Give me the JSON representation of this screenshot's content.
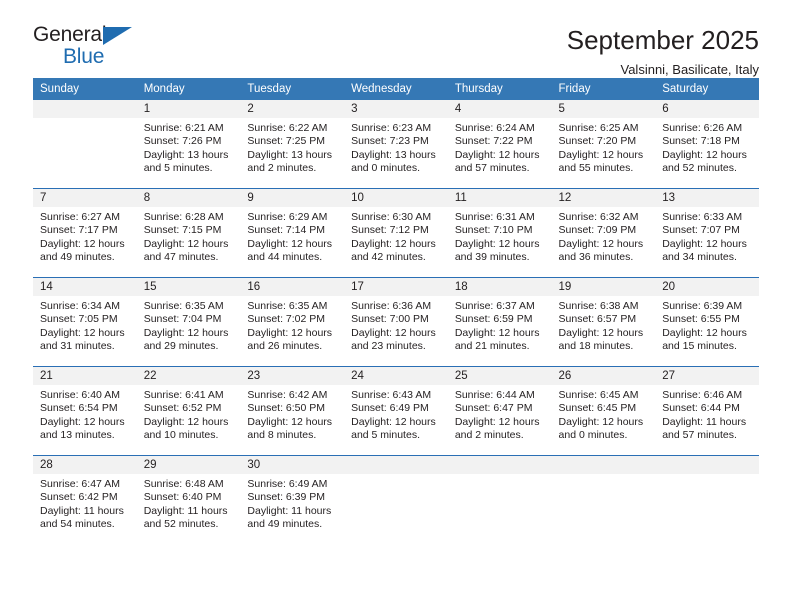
{
  "brand": {
    "name_dark": "General",
    "name_blue": "Blue",
    "accent_color": "#1f6cb0"
  },
  "header": {
    "title": "September 2025",
    "subtitle": "Valsinni, Basilicate, Italy"
  },
  "theme": {
    "header_blue": "#3578b5",
    "row_divider": "#2a6fb5",
    "daynum_band": "#f2f2f2",
    "text": "#231f20"
  },
  "weekdays": [
    "Sunday",
    "Monday",
    "Tuesday",
    "Wednesday",
    "Thursday",
    "Friday",
    "Saturday"
  ],
  "weeks": [
    [
      {
        "day": "",
        "sunrise": "",
        "sunset": "",
        "daylight_1": "",
        "daylight_2": "",
        "empty": true
      },
      {
        "day": "1",
        "sunrise": "Sunrise: 6:21 AM",
        "sunset": "Sunset: 7:26 PM",
        "daylight_1": "Daylight: 13 hours",
        "daylight_2": "and 5 minutes."
      },
      {
        "day": "2",
        "sunrise": "Sunrise: 6:22 AM",
        "sunset": "Sunset: 7:25 PM",
        "daylight_1": "Daylight: 13 hours",
        "daylight_2": "and 2 minutes."
      },
      {
        "day": "3",
        "sunrise": "Sunrise: 6:23 AM",
        "sunset": "Sunset: 7:23 PM",
        "daylight_1": "Daylight: 13 hours",
        "daylight_2": "and 0 minutes."
      },
      {
        "day": "4",
        "sunrise": "Sunrise: 6:24 AM",
        "sunset": "Sunset: 7:22 PM",
        "daylight_1": "Daylight: 12 hours",
        "daylight_2": "and 57 minutes."
      },
      {
        "day": "5",
        "sunrise": "Sunrise: 6:25 AM",
        "sunset": "Sunset: 7:20 PM",
        "daylight_1": "Daylight: 12 hours",
        "daylight_2": "and 55 minutes."
      },
      {
        "day": "6",
        "sunrise": "Sunrise: 6:26 AM",
        "sunset": "Sunset: 7:18 PM",
        "daylight_1": "Daylight: 12 hours",
        "daylight_2": "and 52 minutes."
      }
    ],
    [
      {
        "day": "7",
        "sunrise": "Sunrise: 6:27 AM",
        "sunset": "Sunset: 7:17 PM",
        "daylight_1": "Daylight: 12 hours",
        "daylight_2": "and 49 minutes."
      },
      {
        "day": "8",
        "sunrise": "Sunrise: 6:28 AM",
        "sunset": "Sunset: 7:15 PM",
        "daylight_1": "Daylight: 12 hours",
        "daylight_2": "and 47 minutes."
      },
      {
        "day": "9",
        "sunrise": "Sunrise: 6:29 AM",
        "sunset": "Sunset: 7:14 PM",
        "daylight_1": "Daylight: 12 hours",
        "daylight_2": "and 44 minutes."
      },
      {
        "day": "10",
        "sunrise": "Sunrise: 6:30 AM",
        "sunset": "Sunset: 7:12 PM",
        "daylight_1": "Daylight: 12 hours",
        "daylight_2": "and 42 minutes."
      },
      {
        "day": "11",
        "sunrise": "Sunrise: 6:31 AM",
        "sunset": "Sunset: 7:10 PM",
        "daylight_1": "Daylight: 12 hours",
        "daylight_2": "and 39 minutes."
      },
      {
        "day": "12",
        "sunrise": "Sunrise: 6:32 AM",
        "sunset": "Sunset: 7:09 PM",
        "daylight_1": "Daylight: 12 hours",
        "daylight_2": "and 36 minutes."
      },
      {
        "day": "13",
        "sunrise": "Sunrise: 6:33 AM",
        "sunset": "Sunset: 7:07 PM",
        "daylight_1": "Daylight: 12 hours",
        "daylight_2": "and 34 minutes."
      }
    ],
    [
      {
        "day": "14",
        "sunrise": "Sunrise: 6:34 AM",
        "sunset": "Sunset: 7:05 PM",
        "daylight_1": "Daylight: 12 hours",
        "daylight_2": "and 31 minutes."
      },
      {
        "day": "15",
        "sunrise": "Sunrise: 6:35 AM",
        "sunset": "Sunset: 7:04 PM",
        "daylight_1": "Daylight: 12 hours",
        "daylight_2": "and 29 minutes."
      },
      {
        "day": "16",
        "sunrise": "Sunrise: 6:35 AM",
        "sunset": "Sunset: 7:02 PM",
        "daylight_1": "Daylight: 12 hours",
        "daylight_2": "and 26 minutes."
      },
      {
        "day": "17",
        "sunrise": "Sunrise: 6:36 AM",
        "sunset": "Sunset: 7:00 PM",
        "daylight_1": "Daylight: 12 hours",
        "daylight_2": "and 23 minutes."
      },
      {
        "day": "18",
        "sunrise": "Sunrise: 6:37 AM",
        "sunset": "Sunset: 6:59 PM",
        "daylight_1": "Daylight: 12 hours",
        "daylight_2": "and 21 minutes."
      },
      {
        "day": "19",
        "sunrise": "Sunrise: 6:38 AM",
        "sunset": "Sunset: 6:57 PM",
        "daylight_1": "Daylight: 12 hours",
        "daylight_2": "and 18 minutes."
      },
      {
        "day": "20",
        "sunrise": "Sunrise: 6:39 AM",
        "sunset": "Sunset: 6:55 PM",
        "daylight_1": "Daylight: 12 hours",
        "daylight_2": "and 15 minutes."
      }
    ],
    [
      {
        "day": "21",
        "sunrise": "Sunrise: 6:40 AM",
        "sunset": "Sunset: 6:54 PM",
        "daylight_1": "Daylight: 12 hours",
        "daylight_2": "and 13 minutes."
      },
      {
        "day": "22",
        "sunrise": "Sunrise: 6:41 AM",
        "sunset": "Sunset: 6:52 PM",
        "daylight_1": "Daylight: 12 hours",
        "daylight_2": "and 10 minutes."
      },
      {
        "day": "23",
        "sunrise": "Sunrise: 6:42 AM",
        "sunset": "Sunset: 6:50 PM",
        "daylight_1": "Daylight: 12 hours",
        "daylight_2": "and 8 minutes."
      },
      {
        "day": "24",
        "sunrise": "Sunrise: 6:43 AM",
        "sunset": "Sunset: 6:49 PM",
        "daylight_1": "Daylight: 12 hours",
        "daylight_2": "and 5 minutes."
      },
      {
        "day": "25",
        "sunrise": "Sunrise: 6:44 AM",
        "sunset": "Sunset: 6:47 PM",
        "daylight_1": "Daylight: 12 hours",
        "daylight_2": "and 2 minutes."
      },
      {
        "day": "26",
        "sunrise": "Sunrise: 6:45 AM",
        "sunset": "Sunset: 6:45 PM",
        "daylight_1": "Daylight: 12 hours",
        "daylight_2": "and 0 minutes."
      },
      {
        "day": "27",
        "sunrise": "Sunrise: 6:46 AM",
        "sunset": "Sunset: 6:44 PM",
        "daylight_1": "Daylight: 11 hours",
        "daylight_2": "and 57 minutes."
      }
    ],
    [
      {
        "day": "28",
        "sunrise": "Sunrise: 6:47 AM",
        "sunset": "Sunset: 6:42 PM",
        "daylight_1": "Daylight: 11 hours",
        "daylight_2": "and 54 minutes."
      },
      {
        "day": "29",
        "sunrise": "Sunrise: 6:48 AM",
        "sunset": "Sunset: 6:40 PM",
        "daylight_1": "Daylight: 11 hours",
        "daylight_2": "and 52 minutes."
      },
      {
        "day": "30",
        "sunrise": "Sunrise: 6:49 AM",
        "sunset": "Sunset: 6:39 PM",
        "daylight_1": "Daylight: 11 hours",
        "daylight_2": "and 49 minutes."
      },
      {
        "day": "",
        "sunrise": "",
        "sunset": "",
        "daylight_1": "",
        "daylight_2": "",
        "empty": true
      },
      {
        "day": "",
        "sunrise": "",
        "sunset": "",
        "daylight_1": "",
        "daylight_2": "",
        "empty": true
      },
      {
        "day": "",
        "sunrise": "",
        "sunset": "",
        "daylight_1": "",
        "daylight_2": "",
        "empty": true
      },
      {
        "day": "",
        "sunrise": "",
        "sunset": "",
        "daylight_1": "",
        "daylight_2": "",
        "empty": true
      }
    ]
  ]
}
